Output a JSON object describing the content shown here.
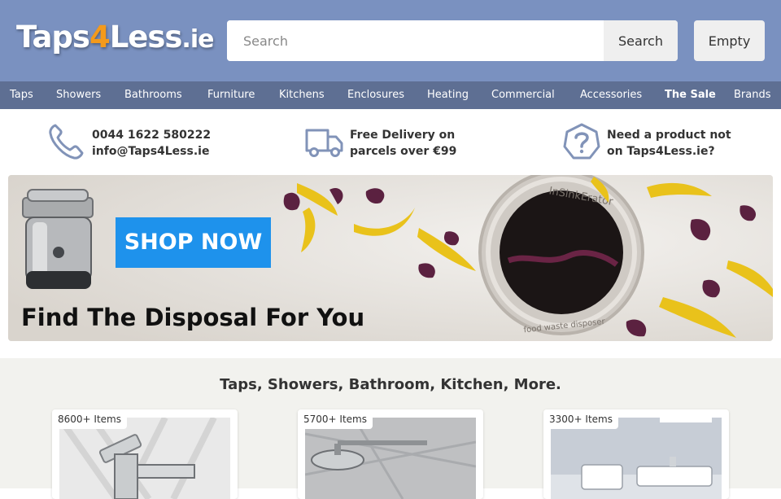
{
  "header": {
    "logo": {
      "part1": "Taps",
      "part2": "4",
      "part3": "Less",
      "part4": ".ie"
    },
    "search": {
      "placeholder": "Search",
      "button": "Search"
    },
    "cart": {
      "label": "Empty"
    }
  },
  "nav": {
    "items": [
      {
        "label": "Taps"
      },
      {
        "label": "Showers"
      },
      {
        "label": "Bathrooms"
      },
      {
        "label": "Furniture"
      },
      {
        "label": "Kitchens"
      },
      {
        "label": "Enclosures"
      },
      {
        "label": "Heating"
      },
      {
        "label": "Commercial"
      },
      {
        "label": "Accessories"
      },
      {
        "label": "The Sale"
      },
      {
        "label": "Brands"
      }
    ]
  },
  "usp": {
    "contact": {
      "icon": "phone-icon",
      "line1": "0044 1622 580222",
      "line2": "info@Taps4Less.ie"
    },
    "delivery": {
      "icon": "truck-icon",
      "line1": "Free Delivery on",
      "line2": "parcels over €99"
    },
    "help": {
      "icon": "question-icon",
      "line1": "Need a product not",
      "line2": "on Taps4Less.ie?"
    }
  },
  "banner": {
    "cta": "SHOP NOW",
    "caption": "Find The Disposal For You",
    "disposer_ring_text": "InSinkErator",
    "disposer_label_text": "food waste disposer"
  },
  "main": {
    "title": "Taps, Showers, Bathroom, Kitchen, More.",
    "categories": [
      {
        "badge": "8600+ Items"
      },
      {
        "badge": "5700+ Items"
      },
      {
        "badge": "3300+ Items"
      }
    ]
  },
  "colors": {
    "header_bg": "#7a91c0",
    "nav_bg": "#5e6f93",
    "logo_accent": "#f49a1b",
    "cta_bg": "#1e92ec",
    "icon_color": "#8193b8"
  }
}
